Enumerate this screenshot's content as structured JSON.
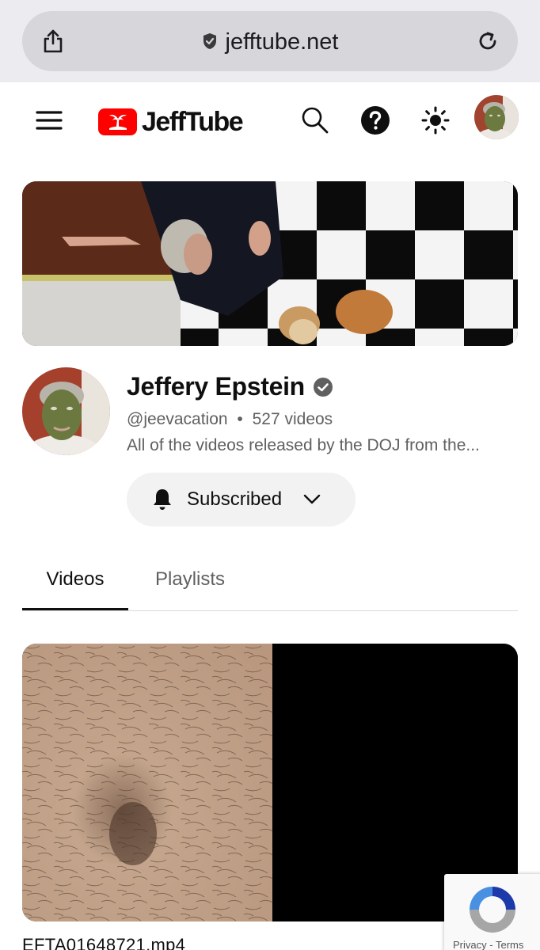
{
  "browser": {
    "url": "jefftube.net",
    "icons": {
      "share": "share-icon",
      "secure": "shield-check-icon",
      "reload": "reload-icon"
    }
  },
  "header": {
    "logo_text": "JeffTube",
    "icons": [
      "menu-icon",
      "search-icon",
      "help-icon",
      "theme-sun-icon"
    ],
    "brand_color": "#ff0000"
  },
  "channel": {
    "name": "Jeffery Epstein",
    "handle": "@jeevacation",
    "separator": "•",
    "video_count": "527 videos",
    "description": "All of the videos released by the DOJ from the...",
    "subscribe_label": "Subscribed"
  },
  "tabs": [
    {
      "label": "Videos",
      "active": true
    },
    {
      "label": "Playlists",
      "active": false
    }
  ],
  "videos": [
    {
      "title": "EFTA01648721.mp4"
    }
  ],
  "recaptcha": {
    "privacy": "Privacy",
    "separator": "-",
    "terms": "Terms"
  }
}
